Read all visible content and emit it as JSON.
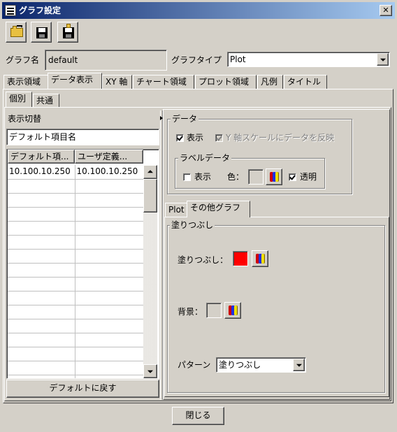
{
  "window": {
    "title": "グラフ設定",
    "close_glyph": "✕"
  },
  "toolbar": {
    "buttons": [
      "open-icon",
      "save-icon",
      "save-as-icon"
    ]
  },
  "graph": {
    "name_label": "グラフ名",
    "name_value": "default",
    "type_label": "グラフタイプ",
    "type_value": "Plot"
  },
  "main_tabs": [
    "表示領域",
    "データ表示",
    "XY 軸",
    "チャート領域",
    "プロット領域",
    "凡例",
    "タイトル"
  ],
  "sub_tabs": [
    "個別",
    "共通"
  ],
  "left": {
    "switch_label": "表示切替",
    "default_item_name": "デフォルト項目名",
    "columns": [
      "デフォルト項...",
      "ユーザ定義..."
    ],
    "rows": [
      [
        "10.100.10.250",
        "10.100.10.250"
      ]
    ],
    "empty_rows": 15,
    "reset_button": "デフォルトに戻す"
  },
  "data_group": {
    "title": "データ",
    "show_label": "表示",
    "show_checked": true,
    "reflect_label": "Y 軸スケールにデータを反映",
    "reflect_checked": true,
    "label_data": {
      "title": "ラベルデータ",
      "show_label": "表示",
      "show_checked": false,
      "color_label": "色：",
      "transparent_label": "透明",
      "transparent_checked": true
    }
  },
  "plot_tabs": [
    "Plot",
    "その他グラフ"
  ],
  "fill_group": {
    "title": "塗りつぶし",
    "fill_label": "塗りつぶし：",
    "fill_color": "#ff0000",
    "background_label": "背景：",
    "background_color": "#d4d0c8",
    "pattern_label": "パターン",
    "pattern_value": "塗りつぶし"
  },
  "footer": {
    "close_button": "閉じる"
  },
  "colors": {
    "titlebar_start": "#0a246a",
    "titlebar_end": "#a6caf0",
    "face": "#d4d0c8"
  }
}
